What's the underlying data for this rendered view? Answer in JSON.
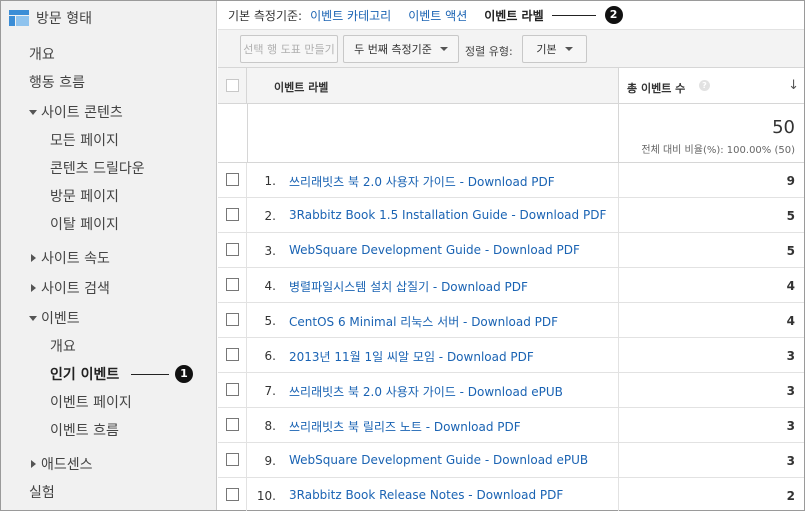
{
  "sidebar": {
    "title": "방문 형태",
    "items": [
      {
        "label": "개요",
        "name": "sidebar-item-overview"
      },
      {
        "label": "행동 흐름",
        "name": "sidebar-item-behavior-flow"
      },
      {
        "label": "사이트 콘텐츠",
        "name": "sidebar-item-site-content"
      },
      {
        "label": "모든 페이지",
        "name": "sidebar-item-all-pages"
      },
      {
        "label": "콘텐츠 드릴다운",
        "name": "sidebar-item-content-drilldown"
      },
      {
        "label": "방문 페이지",
        "name": "sidebar-item-landing-pages"
      },
      {
        "label": "이탈 페이지",
        "name": "sidebar-item-exit-pages"
      },
      {
        "label": "사이트 속도",
        "name": "sidebar-item-site-speed"
      },
      {
        "label": "사이트 검색",
        "name": "sidebar-item-site-search"
      },
      {
        "label": "이벤트",
        "name": "sidebar-item-events"
      },
      {
        "label": "개요",
        "name": "sidebar-item-events-overview"
      },
      {
        "label": "인기 이벤트",
        "name": "sidebar-item-top-events"
      },
      {
        "label": "이벤트 페이지",
        "name": "sidebar-item-event-pages"
      },
      {
        "label": "이벤트 흐름",
        "name": "sidebar-item-events-flow"
      },
      {
        "label": "애드센스",
        "name": "sidebar-item-adsense"
      },
      {
        "label": "실험",
        "name": "sidebar-item-experiments"
      }
    ],
    "callout": "1"
  },
  "dimension_bar": {
    "label": "기본 측정기준:",
    "links": [
      "이벤트 카테고리",
      "이벤트 액션",
      "이벤트 라벨"
    ],
    "active": "이벤트 라벨",
    "callout": "2"
  },
  "toolbar": {
    "plot_rows": "선택 행 도표 만들기",
    "secondary_dimension": "두 번째 측정기준",
    "sort_type_label": "정렬 유형:",
    "sort_type_value": "기본"
  },
  "table": {
    "col_label": "이벤트 라벨",
    "col_metric": "총 이벤트 수",
    "help": "?",
    "sort": "↓",
    "total_value": "50",
    "total_sub": "전체 대비 비율(%): 100.00% (50)",
    "rows": [
      {
        "num": "1.",
        "label": "쓰리래빗츠 북 2.0 사용자 가이드 - Download PDF",
        "value": "9"
      },
      {
        "num": "2.",
        "label": "3Rabbitz Book 1.5 Installation Guide - Download PDF",
        "value": "5"
      },
      {
        "num": "3.",
        "label": "WebSquare Development Guide - Download PDF",
        "value": "5"
      },
      {
        "num": "4.",
        "label": "병렬파일시스템 설치 삽질기 - Download PDF",
        "value": "4"
      },
      {
        "num": "5.",
        "label": "CentOS 6 Minimal 리눅스 서버 - Download PDF",
        "value": "4"
      },
      {
        "num": "6.",
        "label": "2013년 11월 1일 씨알 모임 - Download PDF",
        "value": "3"
      },
      {
        "num": "7.",
        "label": "쓰리래빗츠 북 2.0 사용자 가이드 - Download ePUB",
        "value": "3"
      },
      {
        "num": "8.",
        "label": "쓰리래빗츠 북 릴리즈 노트 - Download PDF",
        "value": "3"
      },
      {
        "num": "9.",
        "label": "WebSquare Development Guide - Download ePUB",
        "value": "3"
      },
      {
        "num": "10.",
        "label": "3Rabbitz Book Release Notes - Download PDF",
        "value": "2"
      }
    ]
  }
}
